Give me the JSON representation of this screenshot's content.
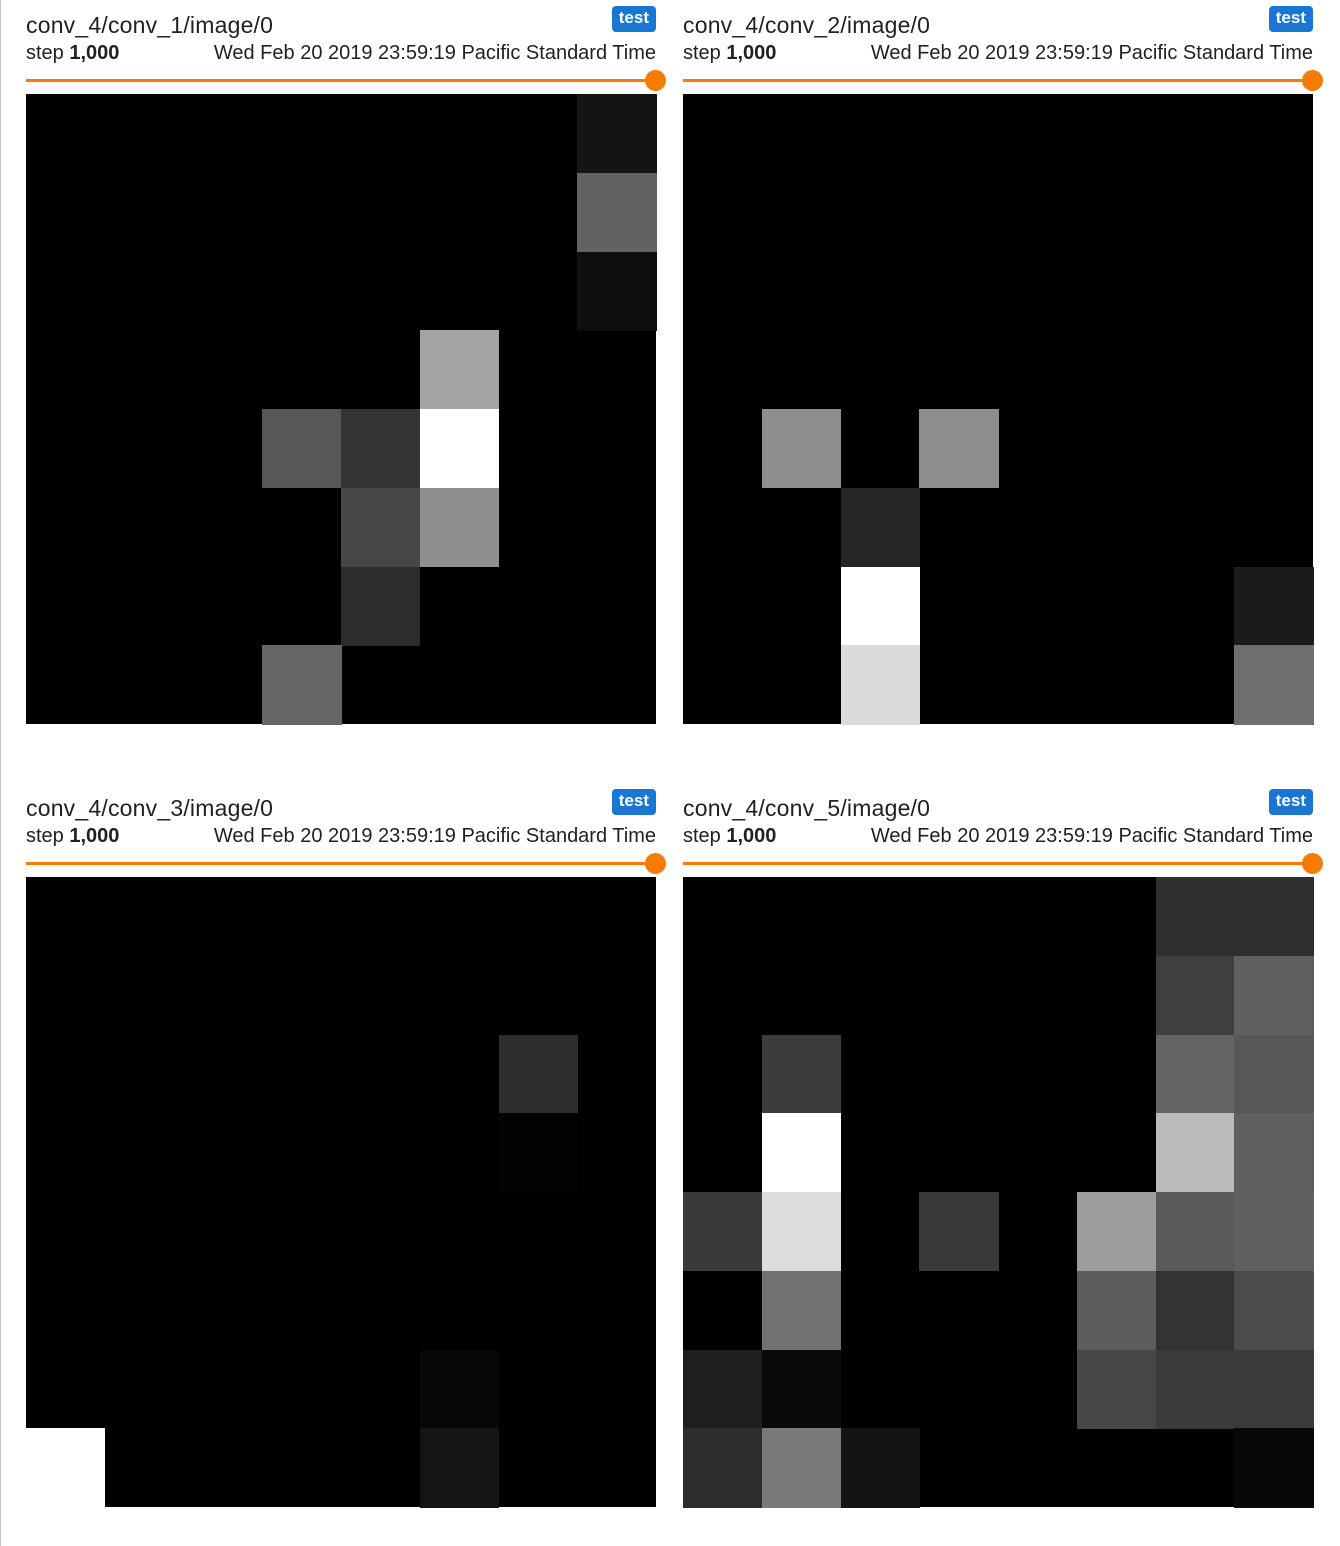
{
  "cards": [
    {
      "title": "conv_4/conv_1/image/0",
      "tag": "test",
      "step_label": "step",
      "step_value": "1,000",
      "timestamp": "Wed Feb 20 2019 23:59:19 Pacific Standard Time",
      "image": {
        "rows": 8,
        "cols": 8,
        "background": "#000000",
        "cells": [
          {
            "r": 0,
            "c": 7,
            "color": "#141414"
          },
          {
            "r": 1,
            "c": 7,
            "color": "#626262"
          },
          {
            "r": 2,
            "c": 7,
            "color": "#0e0e0e"
          },
          {
            "r": 3,
            "c": 5,
            "color": "#a3a3a3"
          },
          {
            "r": 4,
            "c": 3,
            "color": "#575757"
          },
          {
            "r": 4,
            "c": 4,
            "color": "#343434"
          },
          {
            "r": 4,
            "c": 5,
            "color": "#ffffff"
          },
          {
            "r": 5,
            "c": 4,
            "color": "#474747"
          },
          {
            "r": 5,
            "c": 5,
            "color": "#8f8f8f"
          },
          {
            "r": 6,
            "c": 4,
            "color": "#2c2c2c"
          },
          {
            "r": 7,
            "c": 3,
            "color": "#656565"
          }
        ]
      }
    },
    {
      "title": "conv_4/conv_2/image/0",
      "tag": "test",
      "step_label": "step",
      "step_value": "1,000",
      "timestamp": "Wed Feb 20 2019 23:59:19 Pacific Standard Time",
      "image": {
        "rows": 8,
        "cols": 8,
        "background": "#000000",
        "cells": [
          {
            "r": 4,
            "c": 1,
            "color": "#8e8e8e"
          },
          {
            "r": 4,
            "c": 3,
            "color": "#8e8e8e"
          },
          {
            "r": 5,
            "c": 2,
            "color": "#262626"
          },
          {
            "r": 6,
            "c": 2,
            "color": "#ffffff"
          },
          {
            "r": 6,
            "c": 7,
            "color": "#1b1b1b"
          },
          {
            "r": 7,
            "c": 2,
            "color": "#dadada"
          },
          {
            "r": 7,
            "c": 7,
            "color": "#6f6f6f"
          }
        ]
      }
    },
    {
      "title": "conv_4/conv_3/image/0",
      "tag": "test",
      "step_label": "step",
      "step_value": "1,000",
      "timestamp": "Wed Feb 20 2019 23:59:19 Pacific Standard Time",
      "image": {
        "rows": 8,
        "cols": 8,
        "background": "#000000",
        "cells": [
          {
            "r": 2,
            "c": 6,
            "color": "#2e2e2e"
          },
          {
            "r": 3,
            "c": 6,
            "color": "#030303"
          },
          {
            "r": 6,
            "c": 5,
            "color": "#070707"
          },
          {
            "r": 7,
            "c": 0,
            "color": "#ffffff"
          },
          {
            "r": 7,
            "c": 5,
            "color": "#151515"
          }
        ]
      }
    },
    {
      "title": "conv_4/conv_5/image/0",
      "tag": "test",
      "step_label": "step",
      "step_value": "1,000",
      "timestamp": "Wed Feb 20 2019 23:59:19 Pacific Standard Time",
      "image": {
        "rows": 8,
        "cols": 8,
        "background": "#000000",
        "cells": [
          {
            "r": 0,
            "c": 6,
            "color": "#2f2f2f"
          },
          {
            "r": 0,
            "c": 7,
            "color": "#2f2f2f"
          },
          {
            "r": 1,
            "c": 6,
            "color": "#3f3f3f"
          },
          {
            "r": 1,
            "c": 7,
            "color": "#5f5f5f"
          },
          {
            "r": 2,
            "c": 1,
            "color": "#3c3c3c"
          },
          {
            "r": 2,
            "c": 6,
            "color": "#646464"
          },
          {
            "r": 2,
            "c": 7,
            "color": "#575757"
          },
          {
            "r": 3,
            "c": 1,
            "color": "#ffffff"
          },
          {
            "r": 3,
            "c": 6,
            "color": "#bbbbbb"
          },
          {
            "r": 3,
            "c": 7,
            "color": "#5f5f5f"
          },
          {
            "r": 4,
            "c": 0,
            "color": "#3a3a3a"
          },
          {
            "r": 4,
            "c": 1,
            "color": "#dcdcdc"
          },
          {
            "r": 4,
            "c": 3,
            "color": "#393939"
          },
          {
            "r": 4,
            "c": 5,
            "color": "#9d9d9d"
          },
          {
            "r": 4,
            "c": 6,
            "color": "#5a5a5a"
          },
          {
            "r": 4,
            "c": 7,
            "color": "#606060"
          },
          {
            "r": 5,
            "c": 1,
            "color": "#717171"
          },
          {
            "r": 5,
            "c": 5,
            "color": "#5c5c5c"
          },
          {
            "r": 5,
            "c": 6,
            "color": "#333333"
          },
          {
            "r": 5,
            "c": 7,
            "color": "#4c4c4c"
          },
          {
            "r": 6,
            "c": 0,
            "color": "#1e1e1e"
          },
          {
            "r": 6,
            "c": 1,
            "color": "#090909"
          },
          {
            "r": 6,
            "c": 5,
            "color": "#474747"
          },
          {
            "r": 6,
            "c": 6,
            "color": "#3b3b3b"
          },
          {
            "r": 6,
            "c": 7,
            "color": "#3b3b3b"
          },
          {
            "r": 7,
            "c": 0,
            "color": "#2c2c2c"
          },
          {
            "r": 7,
            "c": 1,
            "color": "#7a7a7a"
          },
          {
            "r": 7,
            "c": 2,
            "color": "#141414"
          },
          {
            "r": 7,
            "c": 7,
            "color": "#080808"
          }
        ]
      }
    }
  ]
}
